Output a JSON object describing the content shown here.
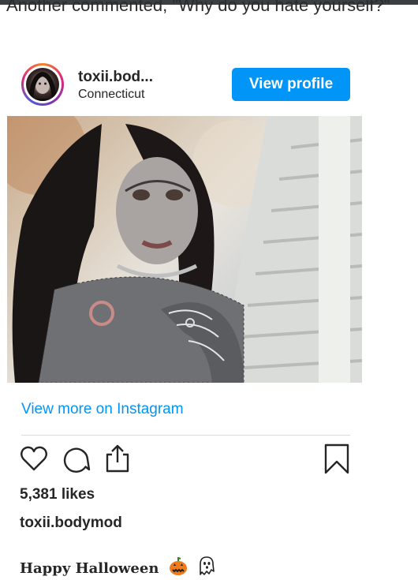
{
  "article": {
    "text": "Another commented, \"Why do you hate yourself?\""
  },
  "embed": {
    "username": "toxii.bod...",
    "location": "Connecticut",
    "view_profile_label": "View profile",
    "view_more_label": "View more on Instagram",
    "likes": "5,381 likes",
    "owner": "toxii.bodymod",
    "caption": "Happy Halloween",
    "caption_emojis": [
      "jack-o-lantern-icon",
      "ghost-icon"
    ]
  },
  "colors": {
    "accent": "#0095f6",
    "text": "#262626",
    "divider": "#dbdbdb"
  }
}
